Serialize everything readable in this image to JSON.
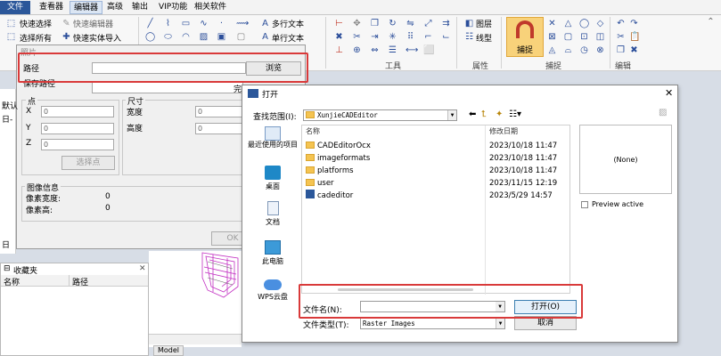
{
  "menu": [
    "文件",
    "查看器",
    "编辑器",
    "高级",
    "输出",
    "VIP功能",
    "相关软件"
  ],
  "ribbon": {
    "select_fast": "快速选择",
    "select_all": "选择所有",
    "fast_editor": "快速编辑器",
    "fast_import": "快速实体导入",
    "mtext": "多行文本",
    "stext": "单行文本",
    "tools": "工具",
    "layer": "图层",
    "linetype": "线型",
    "attributes": "属性",
    "capture_btn": "捕捉",
    "capture_group": "捕捉",
    "edit_group": "编辑"
  },
  "prop_dialog": {
    "title_fragment": "照片",
    "path_label": "路径",
    "save_path_label": "保存路径",
    "browse": "浏览",
    "complete_fragment": "完",
    "point_label": "点",
    "x": "X",
    "y": "Y",
    "z": "Z",
    "x_val": "0",
    "y_val": "0",
    "z_val": "0",
    "pick_point": "选择点",
    "size_label": "尺寸",
    "width_label": "宽度",
    "height_label": "高度",
    "width_val": "0",
    "height_val": "0",
    "image_info": "图像信息",
    "px_w_label": "像素宽度:",
    "px_w_val": "0",
    "px_h_label": "像素高:",
    "px_h_val": "0",
    "ok": "OK"
  },
  "left_panel": {
    "frag_default": "默认",
    "frag_day": "日",
    "favorites": "收藏夹",
    "col_name": "名称",
    "col_path": "路径"
  },
  "canvas": {
    "model_tab": "Model"
  },
  "open_dialog": {
    "title": "打开",
    "lookin_label": "查找范围(I):",
    "lookin_value": "XunjieCADEditor",
    "places": [
      "最近使用的项目",
      "桌面",
      "文档",
      "此电脑",
      "WPS云盘"
    ],
    "col_name": "名称",
    "col_date": "修改日期",
    "files": [
      {
        "name": "CADEditorOcx",
        "date": "2023/10/18 11:47",
        "type": "folder"
      },
      {
        "name": "imageformats",
        "date": "2023/10/18 11:47",
        "type": "folder"
      },
      {
        "name": "platforms",
        "date": "2023/10/18 11:47",
        "type": "folder"
      },
      {
        "name": "user",
        "date": "2023/11/15 12:19",
        "type": "folder"
      },
      {
        "name": "cadeditor",
        "date": "2023/5/29 14:57",
        "type": "app"
      }
    ],
    "preview_none": "(None)",
    "preview_active": "Preview active",
    "filename_label": "文件名(N):",
    "filename_value": "",
    "filetype_label": "文件类型(T):",
    "filetype_value": "Raster Images",
    "open_btn": "打开(O)",
    "cancel_btn": "取消"
  },
  "colors": {
    "accent": "#2b579a",
    "highlight": "#d93a3a",
    "capture": "#f8d27a"
  }
}
